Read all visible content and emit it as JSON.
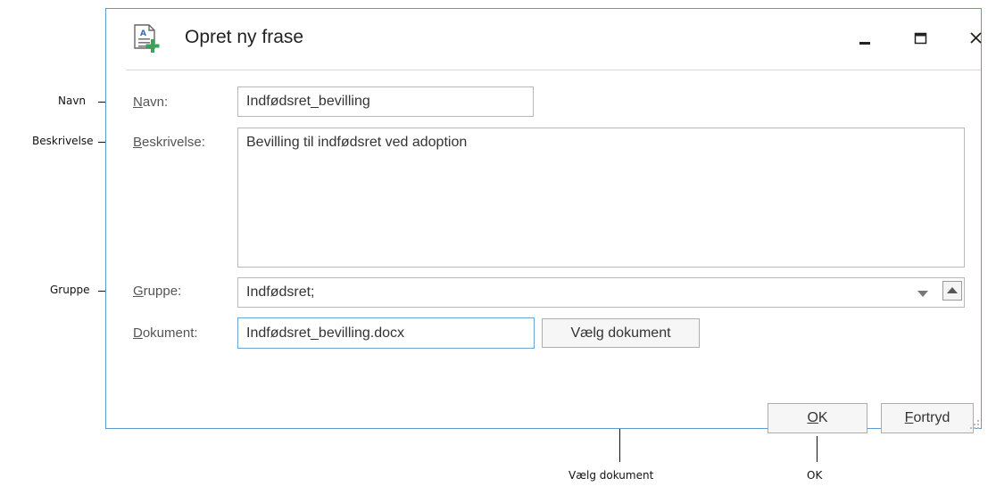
{
  "dialog": {
    "title": "Opret ny frase",
    "window_controls": {
      "minimize_icon": "minimize-icon",
      "maximize_icon": "maximize-icon",
      "close_icon": "close-icon"
    }
  },
  "form": {
    "navn": {
      "label_hot": "N",
      "label_rest": "avn:",
      "value": "Indfødsret_bevilling"
    },
    "beskrivelse": {
      "label_hot": "B",
      "label_rest": "eskrivelse:",
      "value": "Bevilling til indfødsret ved adoption"
    },
    "gruppe": {
      "label_hot": "G",
      "label_rest": "ruppe:",
      "value": "Indfødsret;"
    },
    "dokument": {
      "label_hot": "D",
      "label_rest": "okument:",
      "value": "Indfødsret_bevilling.docx"
    },
    "choose_document_button": "Vælg dokument"
  },
  "buttons": {
    "ok_hot": "O",
    "ok_rest": "K",
    "cancel_hot": "F",
    "cancel_rest": "ortryd"
  },
  "callouts": {
    "navn": "Navn",
    "beskrivelse": "Beskrivelse",
    "gruppe": "Gruppe",
    "vaelg_dokument": "Vælg dokument",
    "ok": "OK"
  },
  "colors": {
    "accent": "#5b9bd5",
    "focus_border": "#6aa3d8"
  }
}
